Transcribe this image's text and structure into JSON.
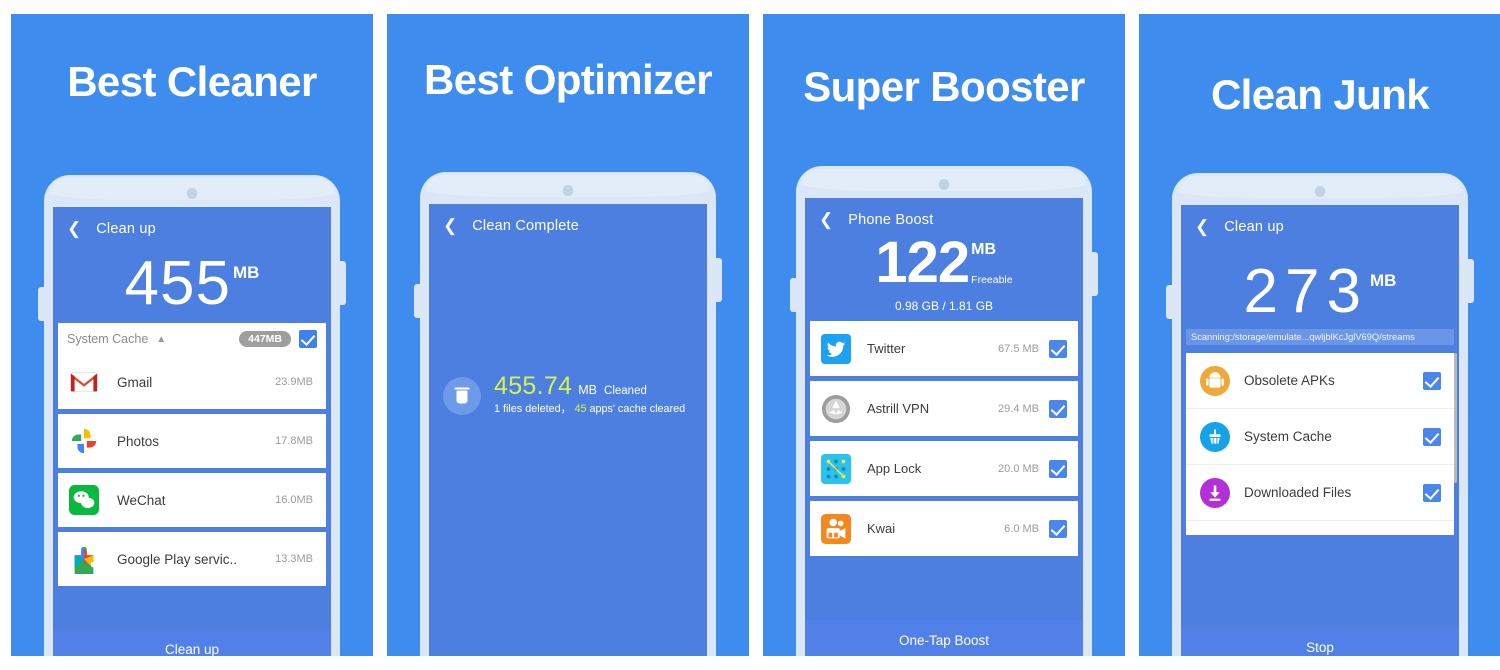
{
  "panels": [
    {
      "title": "Best Cleaner",
      "screen": {
        "back_icon": "chevron-left-icon",
        "header_title": "Clean up",
        "amount": "455",
        "unit": "MB",
        "group": {
          "label": "System Cache",
          "caret_icon": "chevron-up-icon",
          "badge": "447MB"
        },
        "rows": [
          {
            "name": "Gmail",
            "size": "23.9MB",
            "icon": "gmail-icon"
          },
          {
            "name": "Photos",
            "size": "17.8MB",
            "icon": "google-photos-icon"
          },
          {
            "name": "WeChat",
            "size": "16.0MB",
            "icon": "wechat-icon"
          },
          {
            "name": "Google Play servic..",
            "size": "13.3MB",
            "icon": "google-play-services-icon"
          }
        ],
        "cta": "Clean up"
      }
    },
    {
      "title": "Best Optimizer",
      "screen": {
        "back_icon": "chevron-left-icon",
        "header_title": "Clean Complete",
        "cleaned": {
          "icon": "trash-icon",
          "amount": "455.74",
          "unit": "MB",
          "word": "Cleaned",
          "detail_prefix": "1 files deleted，",
          "detail_count": "45",
          "detail_suffix": "apps' cache cleared"
        }
      }
    },
    {
      "title": "Super Booster",
      "screen": {
        "back_icon": "chevron-left-icon",
        "header_title": "Phone Boost",
        "amount": "122",
        "unit": "MB",
        "sub": "Freeable",
        "ratio": "0.98 GB / 1.81 GB",
        "rows": [
          {
            "name": "Twitter",
            "size": "67.5 MB",
            "icon": "twitter-icon",
            "checked": true
          },
          {
            "name": "Astrill VPN",
            "size": "29.4 MB",
            "icon": "astrill-vpn-icon",
            "checked": true
          },
          {
            "name": "App Lock",
            "size": "20.0 MB",
            "icon": "app-lock-icon",
            "checked": true
          },
          {
            "name": "Kwai",
            "size": "6.0 MB",
            "icon": "kwai-icon",
            "checked": true
          }
        ],
        "cta": "One-Tap Boost"
      }
    },
    {
      "title": "Clean Junk",
      "screen": {
        "back_icon": "chevron-left-icon",
        "header_title": "Clean up",
        "amount": "273",
        "unit": "MB",
        "scan_path": "Scanning:/storage/emulate...qwljblKcJglV69Q/streams",
        "rows": [
          {
            "name": "Obsolete APKs",
            "icon": "android-apk-icon",
            "checked": true
          },
          {
            "name": "System Cache",
            "icon": "broom-cache-icon",
            "checked": true
          },
          {
            "name": "Downloaded Files",
            "icon": "download-icon",
            "checked": true
          }
        ],
        "cta": "Stop"
      }
    }
  ],
  "colors": {
    "panel_bg": "#3e8ced",
    "screen_bg": "#4c7fe0",
    "phone_body": "#dbe7f6",
    "cta_bg": "#5180e8",
    "checkbox": "#3f82ef",
    "highlight_yellow": "#d7f24a",
    "badge_gray": "#9e9e9e"
  }
}
